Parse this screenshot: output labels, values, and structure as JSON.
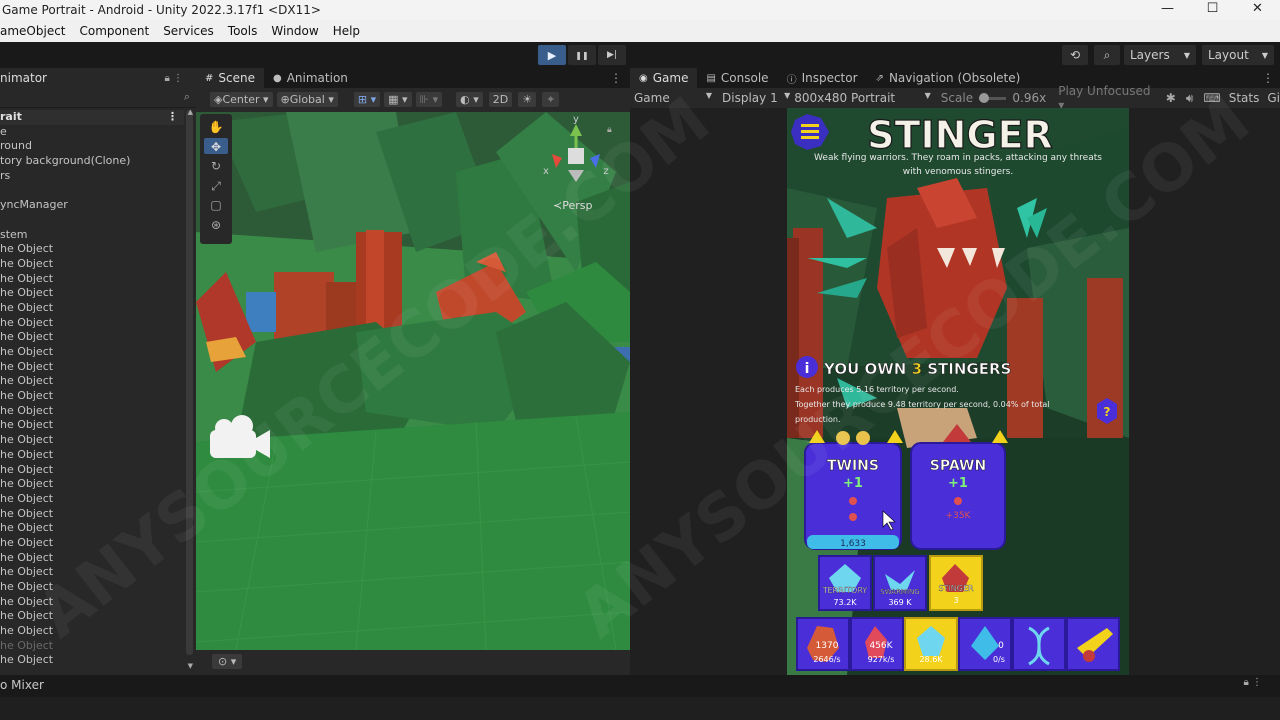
{
  "titlebar": {
    "title": "Game Portrait - Android - Unity 2022.3.17f1 <DX11>",
    "minimize": "—",
    "maximize": "☐",
    "close": "✕"
  },
  "menubar": [
    "ameObject",
    "Component",
    "Services",
    "Tools",
    "Window",
    "Help"
  ],
  "toolbar": {
    "play": "▶",
    "pause": "❚❚",
    "step": "▶|",
    "layers_label": "Layers",
    "layout_label": "Layout"
  },
  "hierarchy": {
    "tab_label": "nimator",
    "scene_name": "rait",
    "items": [
      "e",
      "round",
      "tory background(Clone)",
      "rs",
      "",
      "yncManager",
      "",
      "stem",
      "he Object",
      "he Object",
      "he Object",
      "he Object",
      "he Object",
      "he Object",
      "he Object",
      "he Object",
      "he Object",
      "he Object",
      "he Object",
      "he Object",
      "he Object",
      "he Object",
      "he Object",
      "he Object",
      "he Object",
      "he Object",
      "he Object",
      "he Object",
      "he Object",
      "he Object",
      "he Object",
      "he Object",
      "he Object",
      "he Object",
      "he Object",
      "he Object",
      "he Object",
      "he Object"
    ],
    "dim_index": 35
  },
  "scene": {
    "tabs": [
      {
        "label": "Scene",
        "icon": "grid-icon"
      },
      {
        "label": "Animation",
        "icon": "animation-icon"
      }
    ],
    "center_label": "Center",
    "global_label": "Global",
    "mode_2d": "2D",
    "persp_label": "≺Persp",
    "gizmo_axes": {
      "x": "x",
      "y": "y",
      "z": "z"
    }
  },
  "game": {
    "tabs": [
      "Game",
      "Console",
      "Inspector",
      "Navigation (Obsolete)"
    ],
    "view_label": "Game",
    "display_label": "Display 1",
    "resolution_label": "800x480 Portrait",
    "scale_label": "Scale",
    "scale_value": "0.96x",
    "play_unfocused_label": "Play Unfocused",
    "stats_label": "Stats",
    "gizmos_label": "Gi"
  },
  "game_ui": {
    "title": "STINGER",
    "description_line1": "Weak flying warriors. They roam in packs, attacking any threats",
    "description_line2": "with venomous stingers.",
    "own_prefix": "YOU OWN ",
    "own_count": "3",
    "own_suffix": " STINGERS",
    "produce_line1": "Each produces 5.16 territory per second.",
    "produce_line2": "Together they produce 9.48 territory per second, 0.04% of total",
    "produce_line3": "production.",
    "upgrades": [
      {
        "name": "TWINS",
        "plus": "+1",
        "cost": "1,633"
      },
      {
        "name": "SPAWN",
        "plus": "+1",
        "cost": "+35K"
      }
    ],
    "resources": [
      {
        "name": "TERRITORY",
        "value": "73.2K"
      },
      {
        "name": "SWARMING",
        "value": "369 K"
      },
      {
        "name": "STINGER",
        "value": "3"
      }
    ],
    "units": [
      {
        "value1": "1370",
        "value2": "2646/s"
      },
      {
        "value1": "456K",
        "value2": "927k/s"
      },
      {
        "value1": "",
        "value2": "28.6K"
      },
      {
        "value1": "0",
        "value2": "0/s"
      },
      {
        "value1": "",
        "value2": ""
      },
      {
        "value1": "",
        "value2": ""
      }
    ]
  },
  "bottom": {
    "audio_mixer": "o Mixer"
  },
  "watermark": "ANYSOURCECODE.COM",
  "colors": {
    "accent_blue": "#3a5e8c",
    "card_purple": "#4a2fd8",
    "highlight_yellow": "#f2d21a",
    "ground_green": "#2e8a3e"
  }
}
